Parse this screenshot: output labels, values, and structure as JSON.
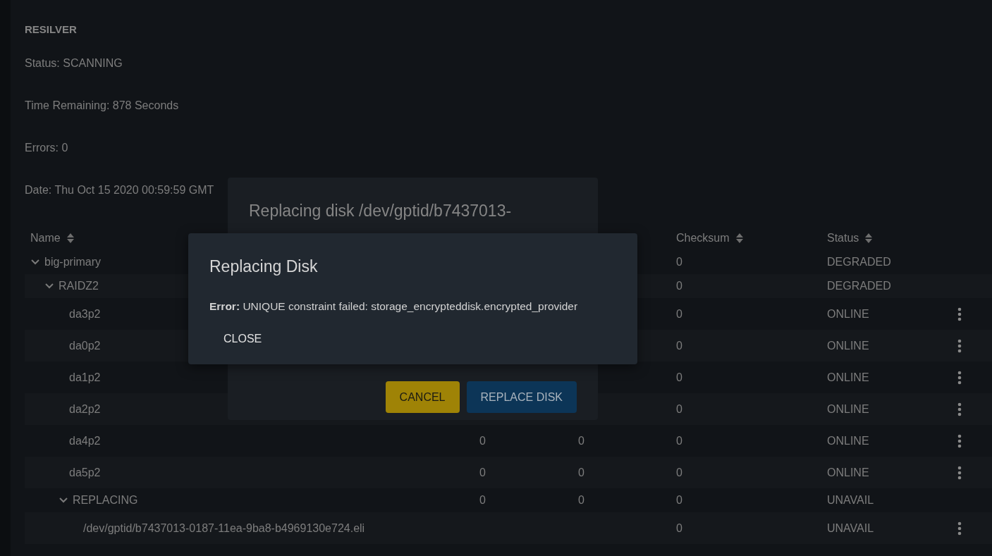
{
  "resilver": {
    "title": "RESILVER",
    "lines": [
      "Status: SCANNING",
      "Time Remaining: 878 Seconds",
      "Errors: 0",
      "Date: Thu Oct 15 2020 00:59:59 GMT"
    ]
  },
  "table": {
    "columns": [
      {
        "label": "Name",
        "sortable": true
      },
      {},
      {},
      {
        "label": "Checksum",
        "sortable": true
      },
      {
        "label": "Status",
        "sortable": true
      }
    ],
    "rows": [
      {
        "name": "big-primary",
        "checksum": "0",
        "status": "DEGRADED",
        "expanded": true,
        "children": [
          {
            "name": "RAIDZ2",
            "checksum": "0",
            "status": "DEGRADED",
            "expanded": true,
            "children": [
              {
                "name": "da3p2",
                "checksum": "0",
                "status": "ONLINE"
              },
              {
                "name": "da0p2",
                "checksum": "0",
                "status": "ONLINE"
              },
              {
                "name": "da1p2",
                "checksum": "0",
                "status": "ONLINE"
              },
              {
                "name": "da2p2",
                "checksum": "0",
                "status": "ONLINE"
              },
              {
                "name": "da4p2",
                "read": "0",
                "write": "0",
                "checksum": "0",
                "status": "ONLINE"
              },
              {
                "name": "da5p2",
                "read": "0",
                "write": "0",
                "checksum": "0",
                "status": "ONLINE"
              },
              {
                "name": "REPLACING",
                "read": "0",
                "write": "0",
                "checksum": "0",
                "status": "UNAVAIL",
                "expanded": true,
                "children": [
                  {
                    "name": "/dev/gptid/b7437013-0187-11ea-9ba8-b4969130e724.eli",
                    "checksum": "0",
                    "status": "UNAVAIL"
                  }
                ]
              }
            ]
          }
        ]
      }
    ]
  },
  "replace_dialog": {
    "title": "Replacing disk /dev/gptid/b7437013-",
    "buttons": [
      {
        "label": "CANCEL",
        "kind": "secondary"
      },
      {
        "label": "REPLACE DISK",
        "kind": "primary"
      }
    ]
  },
  "error_dialog": {
    "title": "Replacing Disk",
    "message": "**Error:** UNIQUE constraint failed: storage_encrypteddisk.encrypted_provider",
    "button": "CLOSE"
  }
}
